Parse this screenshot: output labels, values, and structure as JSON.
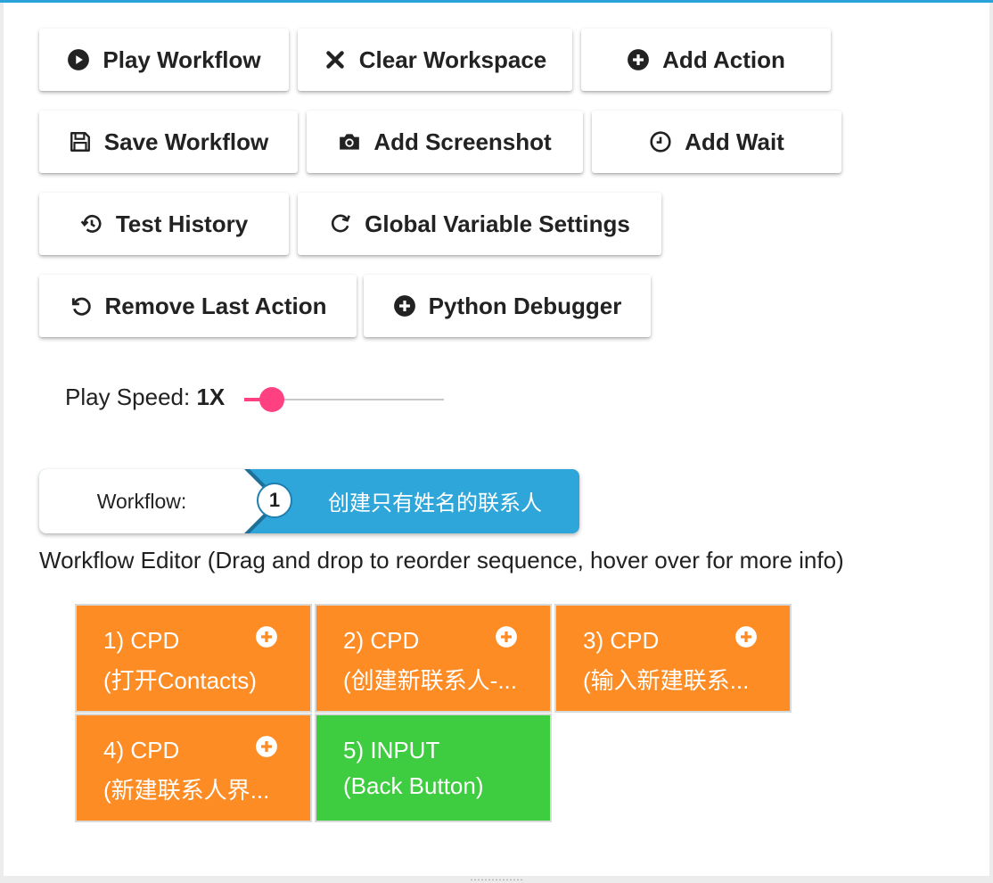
{
  "toolbar": {
    "play_workflow": "Play Workflow",
    "clear_workspace": "Clear Workspace",
    "add_action": "Add Action",
    "save_workflow": "Save Workflow",
    "add_screenshot": "Add Screenshot",
    "add_wait": "Add Wait",
    "test_history": "Test History",
    "global_variable_settings": "Global Variable Settings",
    "remove_last_action": "Remove Last Action",
    "python_debugger": "Python Debugger"
  },
  "play_speed": {
    "label": "Play Speed:",
    "value": "1X",
    "level": 0.14
  },
  "breadcrumb": {
    "label": "Workflow:",
    "step_number": "1",
    "title": "创建只有姓名的联系人"
  },
  "editor": {
    "label": "Workflow Editor (Drag and drop to reorder sequence, hover over for more info)",
    "tiles": [
      {
        "title": "1) CPD",
        "subtitle": "(打开Contacts)",
        "color": "#fd8c25"
      },
      {
        "title": "2) CPD",
        "subtitle": "(创建新联系人-...",
        "color": "#fd8c25"
      },
      {
        "title": "3) CPD",
        "subtitle": "(输入新建联系...",
        "color": "#fd8c25"
      },
      {
        "title": "4) CPD",
        "subtitle": "(新建联系人界...",
        "color": "#fd8c25"
      },
      {
        "title": "5) INPUT",
        "subtitle": "(Back Button)",
        "color": "#3ecc40"
      }
    ]
  },
  "colors": {
    "accent_blue": "#2fa6d9",
    "slider_pink": "#ff4081",
    "cpd_orange": "#fd8c25",
    "input_green": "#3ecc40"
  }
}
